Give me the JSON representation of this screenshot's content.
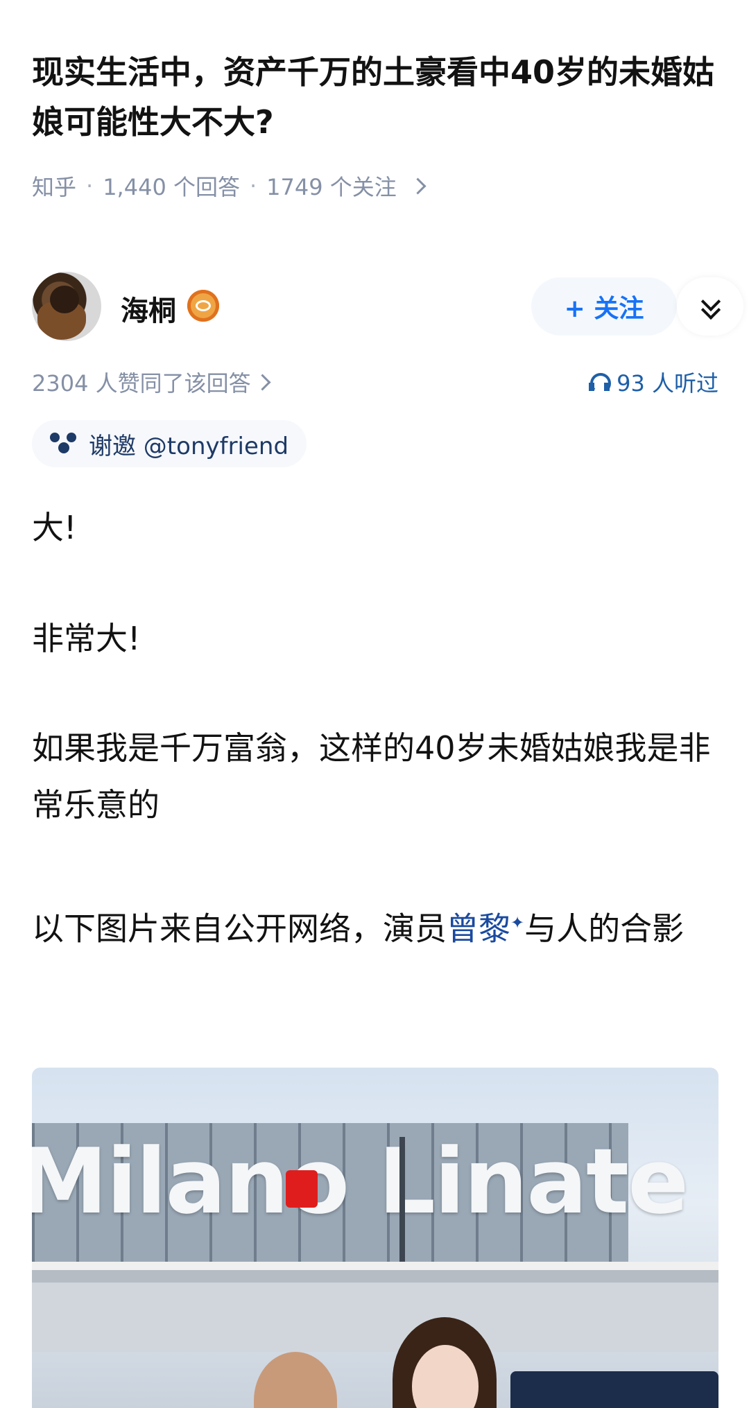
{
  "question": {
    "title": "现实生活中，资产千万的土豪看中40岁的未婚姑娘可能性大不大?",
    "source": "知乎",
    "answers": "1,440 个回答",
    "follows": "1749 个关注"
  },
  "author": {
    "name": "海桐",
    "follow_label": "+ 关注"
  },
  "stats": {
    "approve_text": "2304 人赞同了该回答",
    "listen_text": "93 人听过"
  },
  "invite": {
    "label": "谢邀 @tonyfriend"
  },
  "answer": {
    "p1": "大!",
    "p2": "非常大!",
    "p3": "如果我是千万富翁，这样的40岁未婚姑娘我是非常乐意的",
    "p4_before": "以下图片来自公开网络，演员",
    "p4_link": "曾黎",
    "p4_after": "与人的合影"
  },
  "photo": {
    "sign_text": "Milano Linate"
  },
  "colors": {
    "link": "#1a4aa0",
    "accent": "#1772f6",
    "meta": "#8590a6"
  }
}
